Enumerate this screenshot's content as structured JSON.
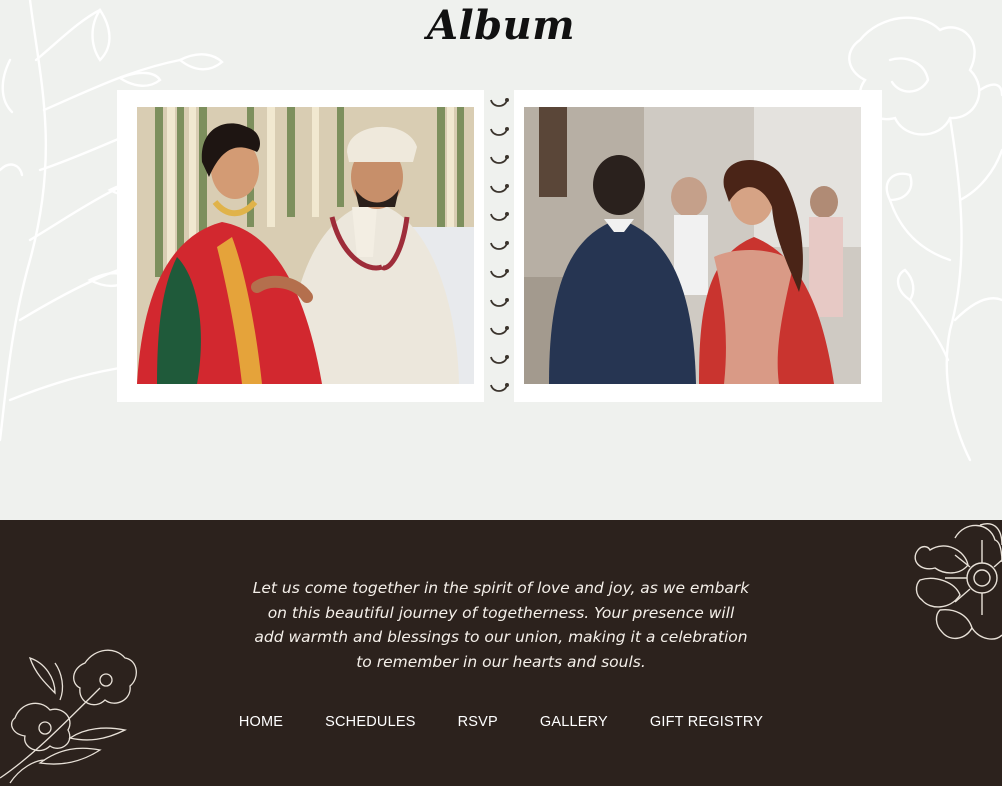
{
  "album": {
    "title": "Album",
    "photos": [
      {
        "alt": ""
      },
      {
        "alt": ""
      }
    ]
  },
  "footer": {
    "message": "Let us come together in the spirit of love and joy, as we embark on this beautiful journey of togetherness. Your presence will add warmth and blessings to our union, making it a celebration to remember in our hearts and souls.",
    "nav": [
      "HOME",
      "SCHEDULES",
      "RSVP",
      "GALLERY",
      "GIFT REGISTRY"
    ]
  },
  "colors": {
    "background": "#eff1ee",
    "footer_background": "#2c221d",
    "footer_text": "#f4efe9",
    "card": "#ffffff",
    "ring": "#3b342d"
  },
  "icons": [
    "floral-branch-icon",
    "flower-outline-icon",
    "spiral-binding-ring-icon"
  ]
}
